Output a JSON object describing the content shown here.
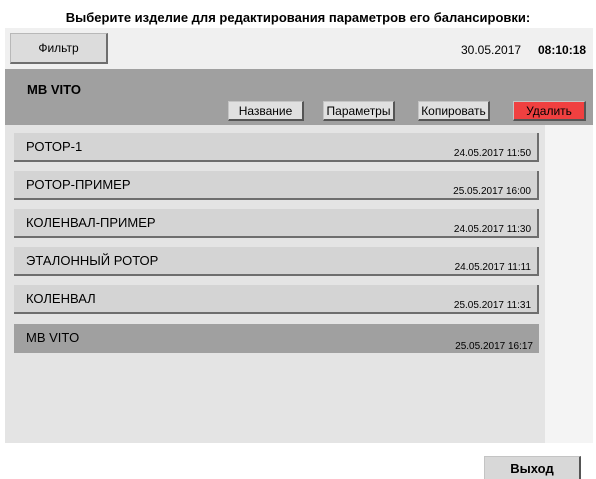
{
  "title": "Выберите изделие для редактирования параметров его балансировки:",
  "toolbar": {
    "filter_label": "Фильтр",
    "date": "30.05.2017",
    "time": "08:10:18"
  },
  "selected": {
    "name": "MB VITO",
    "buttons": {
      "name": "Название",
      "params": "Параметры",
      "copy": "Копировать",
      "delete": "Удалить"
    },
    "delete_color": "#f04040"
  },
  "items": [
    {
      "name": "РОТОР-1",
      "date": "24.05.2017 11:50"
    },
    {
      "name": "РОТОР-ПРИМЕР",
      "date": "25.05.2017 16:00"
    },
    {
      "name": "КОЛЕНВАЛ-ПРИМЕР",
      "date": "24.05.2017 11:30"
    },
    {
      "name": "ЭТАЛОННЫЙ РОТОР",
      "date": "24.05.2017 11:11"
    },
    {
      "name": "КОЛЕНВАЛ",
      "date": "25.05.2017 11:31"
    },
    {
      "name": "MB VITO",
      "date": "25.05.2017 16:17"
    }
  ],
  "selected_index": 5,
  "exit_label": "Выход"
}
